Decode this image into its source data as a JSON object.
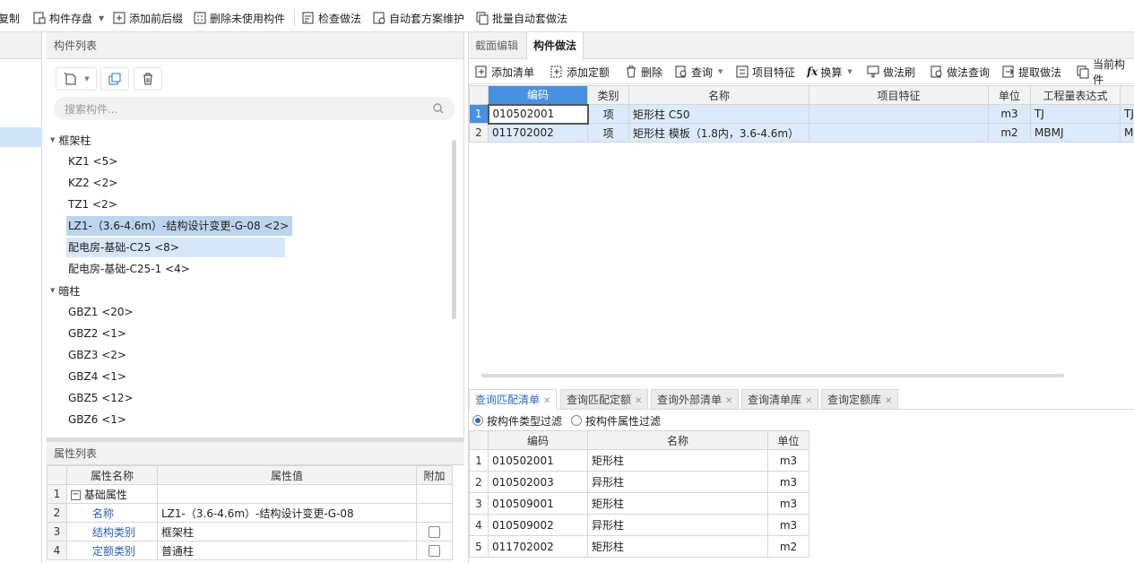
{
  "toolbar": {
    "items": [
      {
        "label": "复制",
        "icon": "copy-icon"
      },
      {
        "label": "构件存盘",
        "icon": "save-component-icon",
        "dropdown": true
      },
      {
        "label": "添加前后缀",
        "icon": "add-prefix-suffix-icon"
      },
      {
        "label": "删除未使用构件",
        "icon": "delete-unused-icon"
      },
      {
        "label": "检查做法",
        "icon": "check-method-icon"
      },
      {
        "label": "自动套方案维护",
        "icon": "auto-scheme-icon"
      },
      {
        "label": "批量自动套做法",
        "icon": "batch-auto-icon"
      }
    ]
  },
  "component_list": {
    "title": "构件列表",
    "search_placeholder": "搜索构件...",
    "groups": [
      {
        "name": "框架柱",
        "items": [
          "KZ1 <5>",
          "KZ2 <2>",
          "TZ1 <2>",
          "LZ1-（3.6-4.6m）-结构设计变更-G-08 <2>",
          "配电房-基础-C25 <8>",
          "配电房-基础-C25-1 <4>"
        ]
      },
      {
        "name": "暗柱",
        "items": [
          "GBZ1 <20>",
          "GBZ2 <1>",
          "GBZ3 <2>",
          "GBZ4 <1>",
          "GBZ5 <12>",
          "GBZ6 <1>"
        ]
      }
    ]
  },
  "property_list": {
    "title": "属性列表",
    "headers": [
      "属性名称",
      "属性值",
      "附加"
    ],
    "rows": [
      {
        "num": "1",
        "name": "基础属性",
        "value": "",
        "group": true
      },
      {
        "num": "2",
        "name": "名称",
        "value": "LZ1-（3.6-4.6m）-结构设计变更-G-08",
        "checkbox": false
      },
      {
        "num": "3",
        "name": "结构类别",
        "value": "框架柱",
        "checkbox": true
      },
      {
        "num": "4",
        "name": "定额类别",
        "value": "普通柱",
        "checkbox": true
      }
    ]
  },
  "right_tabs": [
    "截面编辑",
    "构件做法"
  ],
  "right_toolbar": [
    {
      "label": "添加清单",
      "icon": "add-list-icon"
    },
    {
      "label": "添加定额",
      "icon": "add-quota-icon"
    },
    {
      "label": "删除",
      "icon": "trash-icon"
    },
    {
      "label": "查询",
      "icon": "query-icon",
      "dropdown": true
    },
    {
      "label": "项目特征",
      "icon": "feature-icon"
    },
    {
      "label": "换算",
      "icon": "fx-icon",
      "dropdown": true
    },
    {
      "label": "做法刷",
      "icon": "brush-icon"
    },
    {
      "label": "做法查询",
      "icon": "method-query-icon"
    },
    {
      "label": "提取做法",
      "icon": "extract-icon"
    },
    {
      "label": "当前构件",
      "icon": "current-component-icon"
    }
  ],
  "bom_table": {
    "headers": [
      "编码",
      "类别",
      "名称",
      "项目特征",
      "单位",
      "工程量表达式",
      ""
    ],
    "rows": [
      {
        "num": "1",
        "code": "010502001",
        "type": "项",
        "name": "矩形柱 C50",
        "feature": "",
        "unit": "m3",
        "expr": "TJ",
        "extra": "TJ"
      },
      {
        "num": "2",
        "code": "011702002",
        "type": "项",
        "name": "矩形柱 模板（1.8内，3.6-4.6m）",
        "feature": "",
        "unit": "m2",
        "expr": "MBMJ",
        "extra": "M"
      }
    ]
  },
  "bottom_tabs": [
    "查询匹配清单",
    "查询匹配定额",
    "查询外部清单",
    "查询清单库",
    "查询定额库"
  ],
  "filters": [
    "按构件类型过滤",
    "按构件属性过滤"
  ],
  "match_table": {
    "headers": [
      "编码",
      "名称",
      "单位"
    ],
    "rows": [
      {
        "num": "1",
        "code": "010502001",
        "name": "矩形柱",
        "unit": "m3"
      },
      {
        "num": "2",
        "code": "010502003",
        "name": "异形柱",
        "unit": "m3"
      },
      {
        "num": "3",
        "code": "010509001",
        "name": "矩形柱",
        "unit": "m3"
      },
      {
        "num": "4",
        "code": "010509002",
        "name": "异形柱",
        "unit": "m3"
      },
      {
        "num": "5",
        "code": "011702002",
        "name": "矩形柱",
        "unit": "m2"
      }
    ]
  }
}
